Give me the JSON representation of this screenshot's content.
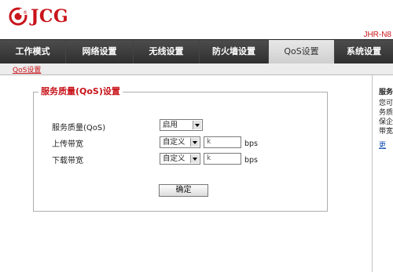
{
  "brand": {
    "name": "JCG",
    "model": "JHR-N8"
  },
  "nav": {
    "items": [
      {
        "label": "工作模式",
        "active": false
      },
      {
        "label": "网络设置",
        "active": false
      },
      {
        "label": "无线设置",
        "active": false
      },
      {
        "label": "防火墙设置",
        "active": false
      },
      {
        "label": "QoS设置",
        "active": true
      },
      {
        "label": "系统设置",
        "active": false
      }
    ]
  },
  "subnav": {
    "link": "QoS设置"
  },
  "qos": {
    "legend": "服务质量(QoS)设置",
    "service": {
      "label": "服务质量(QoS)",
      "value": "启用"
    },
    "upload": {
      "label": "上传带宽",
      "mode": "自定义",
      "value": "k",
      "unit": "bps"
    },
    "download": {
      "label": "下载带宽",
      "mode": "自定义",
      "value": "k",
      "unit": "bps"
    },
    "confirm": "确定"
  },
  "help": {
    "title": "服务",
    "lines": [
      "您可",
      "务质",
      "保企",
      "带宽"
    ],
    "more": "更"
  },
  "colors": {
    "accent": "#c8141a",
    "nav_bg": "#3a3a3a",
    "link": "#1c55b3"
  }
}
